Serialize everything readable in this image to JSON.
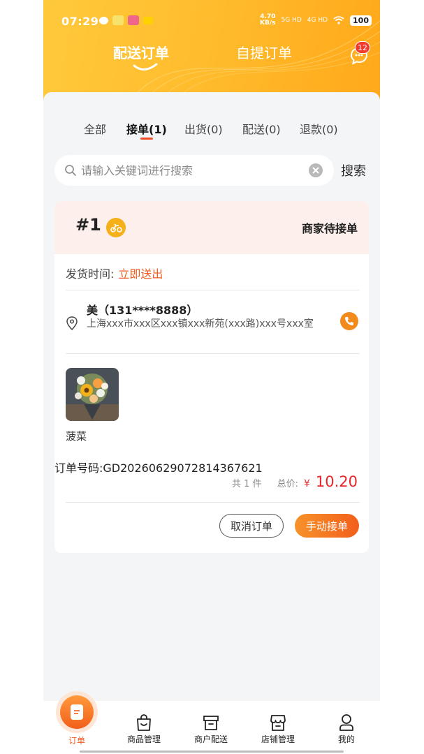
{
  "status_bar": {
    "time": "07:29",
    "net_speed_value": "4.70",
    "net_speed_unit": "KB/s",
    "signal_1": "5G HD",
    "signal_2": "4G HD",
    "battery": "100",
    "icons": [
      "wechat-icon",
      "app-icon",
      "app-icon",
      "meituan-icon"
    ]
  },
  "header": {
    "tabs": [
      {
        "label": "配送订单",
        "active": true
      },
      {
        "label": "自提订单",
        "active": false
      }
    ],
    "message_badge": "12",
    "message_icon": "chat-bubble-icon"
  },
  "status_tabs": [
    {
      "label": "全部",
      "active": false
    },
    {
      "label": "接单(1)",
      "active": true
    },
    {
      "label": "出货(0)",
      "active": false
    },
    {
      "label": "配送(0)",
      "active": false
    },
    {
      "label": "退款(0)",
      "active": false
    }
  ],
  "search": {
    "placeholder": "请输入关键词进行搜索",
    "value": "",
    "button_label": "搜索"
  },
  "order": {
    "number": "#1",
    "tag_icon": "delivery-rider-icon",
    "state": "商家待接单",
    "ship_time_label": "发货时间:",
    "ship_time_value": "立即送出",
    "recipient": "美（131****8888）",
    "address": "上海xxx市xxx区xxx镇xxx新苑(xxx路)xxx号xxx室",
    "goods_name": "菠菜",
    "order_code": "订单号码:GD20260629072814367621",
    "quantity": "共 1 件",
    "total_label": "总价:",
    "currency": "¥",
    "total": "10.20",
    "cancel_label": "取消订单",
    "accept_label": "手动接单"
  },
  "bottom_nav": [
    {
      "label": "订单",
      "icon": "order-icon",
      "active": true
    },
    {
      "label": "商品管理",
      "icon": "shopping-bag-icon",
      "active": false
    },
    {
      "label": "商户配送",
      "icon": "box-icon",
      "active": false
    },
    {
      "label": "店铺管理",
      "icon": "store-icon",
      "active": false
    },
    {
      "label": "我的",
      "icon": "user-icon",
      "active": false
    }
  ],
  "colors": {
    "header_gradient": [
      "#ffc93c",
      "#ffa91a"
    ],
    "accent_orange": "#f05a1f",
    "price_red": "#e8262a",
    "card_head_bg": "#fdf0ec"
  }
}
